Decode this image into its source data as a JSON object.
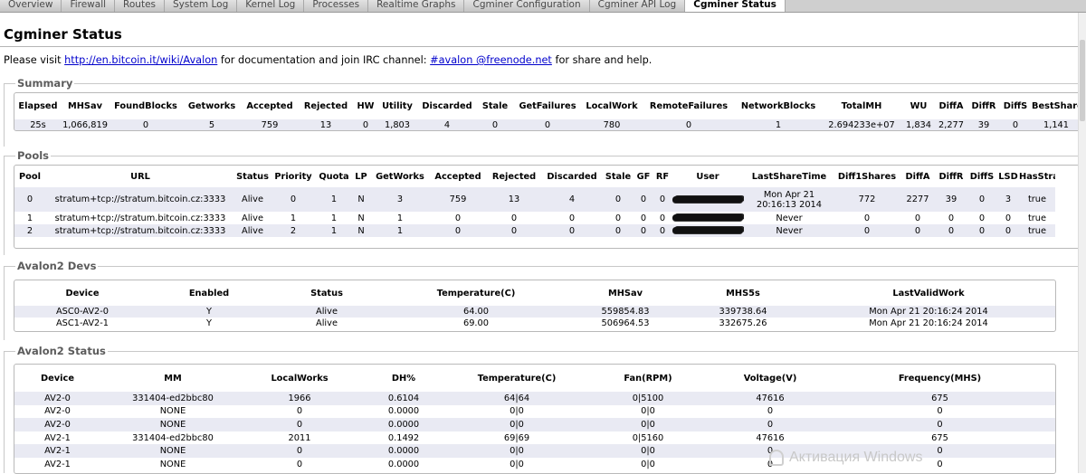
{
  "tabs": [
    {
      "label": "Overview",
      "active": false
    },
    {
      "label": "Firewall",
      "active": false
    },
    {
      "label": "Routes",
      "active": false
    },
    {
      "label": "System Log",
      "active": false
    },
    {
      "label": "Kernel Log",
      "active": false
    },
    {
      "label": "Processes",
      "active": false
    },
    {
      "label": "Realtime Graphs",
      "active": false
    },
    {
      "label": "Cgminer Configuration",
      "active": false
    },
    {
      "label": "Cgminer API Log",
      "active": false
    },
    {
      "label": "Cgminer Status",
      "active": true
    }
  ],
  "page": {
    "title": "Cgminer Status",
    "intro_before": "Please visit ",
    "intro_link1": "http://en.bitcoin.it/wiki/Avalon",
    "intro_middle": " for documentation and join IRC channel: ",
    "intro_link2": "#avalon @freenode.net",
    "intro_after": " for share and help."
  },
  "summary": {
    "legend": "Summary",
    "headers": [
      "Elapsed",
      "MHSav",
      "FoundBlocks",
      "Getworks",
      "Accepted",
      "Rejected",
      "HW",
      "Utility",
      "Discarded",
      "Stale",
      "GetFailures",
      "LocalWork",
      "RemoteFailures",
      "NetworkBlocks",
      "TotalMH",
      "WU",
      "DiffA",
      "DiffR",
      "DiffS",
      "BestShare"
    ],
    "rows": [
      [
        "25s",
        "1,066,819",
        "0",
        "5",
        "759",
        "13",
        "0",
        "1,803",
        "4",
        "0",
        "0",
        "780",
        "0",
        "1",
        "2.694233e+07",
        "1,834",
        "2,277",
        "39",
        "0",
        "1,141"
      ]
    ]
  },
  "pools": {
    "legend": "Pools",
    "headers": [
      "Pool",
      "URL",
      "Status",
      "Priority",
      "Quota",
      "LP",
      "GetWorks",
      "Accepted",
      "Rejected",
      "Discarded",
      "Stale",
      "GF",
      "RF",
      "User",
      "LastShareTime",
      "Diff1Shares",
      "DiffA",
      "DiffR",
      "DiffS",
      "LSD",
      "HasStratu"
    ],
    "rows": [
      [
        "0",
        "stratum+tcp://stratum.bitcoin.cz:3333",
        "Alive",
        "0",
        "1",
        "N",
        "3",
        "759",
        "13",
        "4",
        "0",
        "0",
        "0",
        "",
        "Mon Apr 21\n20:16:13 2014",
        "772",
        "2277",
        "39",
        "0",
        "3",
        "true"
      ],
      [
        "1",
        "stratum+tcp://stratum.bitcoin.cz:3333",
        "Alive",
        "1",
        "1",
        "N",
        "1",
        "0",
        "0",
        "0",
        "0",
        "0",
        "0",
        "",
        "Never",
        "0",
        "0",
        "0",
        "0",
        "0",
        "true"
      ],
      [
        "2",
        "stratum+tcp://stratum.bitcoin.cz:3333",
        "Alive",
        "2",
        "1",
        "N",
        "1",
        "0",
        "0",
        "0",
        "0",
        "0",
        "0",
        "",
        "Never",
        "0",
        "0",
        "0",
        "0",
        "0",
        "true"
      ]
    ]
  },
  "devs": {
    "legend": "Avalon2 Devs",
    "headers": [
      "Device",
      "Enabled",
      "Status",
      "Temperature(C)",
      "MHSav",
      "MHS5s",
      "LastValidWork"
    ],
    "rows": [
      [
        "ASC0-AV2-0",
        "Y",
        "Alive",
        "64.00",
        "559854.83",
        "339738.64",
        "Mon Apr 21 20:16:24 2014"
      ],
      [
        "ASC1-AV2-1",
        "Y",
        "Alive",
        "69.00",
        "506964.53",
        "332675.26",
        "Mon Apr 21 20:16:24 2014"
      ]
    ]
  },
  "avstatus": {
    "legend": "Avalon2 Status",
    "headers": [
      "Device",
      "MM",
      "LocalWorks",
      "DH%",
      "Temperature(C)",
      "Fan(RPM)",
      "Voltage(V)",
      "Frequency(MHS)"
    ],
    "rows": [
      [
        "AV2-0",
        "331404-ed2bbc80",
        "1966",
        "0.6104",
        "64|64",
        "0|5100",
        "47616",
        "675"
      ],
      [
        "AV2-0",
        "NONE",
        "0",
        "0.0000",
        "0|0",
        "0|0",
        "0",
        "0"
      ],
      [
        "AV2-0",
        "NONE",
        "0",
        "0.0000",
        "0|0",
        "0|0",
        "0",
        "0"
      ],
      [
        "AV2-1",
        "331404-ed2bbc80",
        "2011",
        "0.1492",
        "69|69",
        "0|5160",
        "47616",
        "675"
      ],
      [
        "AV2-1",
        "NONE",
        "0",
        "0.0000",
        "0|0",
        "0|0",
        "0",
        "0"
      ],
      [
        "AV2-1",
        "NONE",
        "0",
        "0.0000",
        "0|0",
        "0|0",
        "0",
        "0"
      ]
    ]
  },
  "watermark": "Активация Windows"
}
